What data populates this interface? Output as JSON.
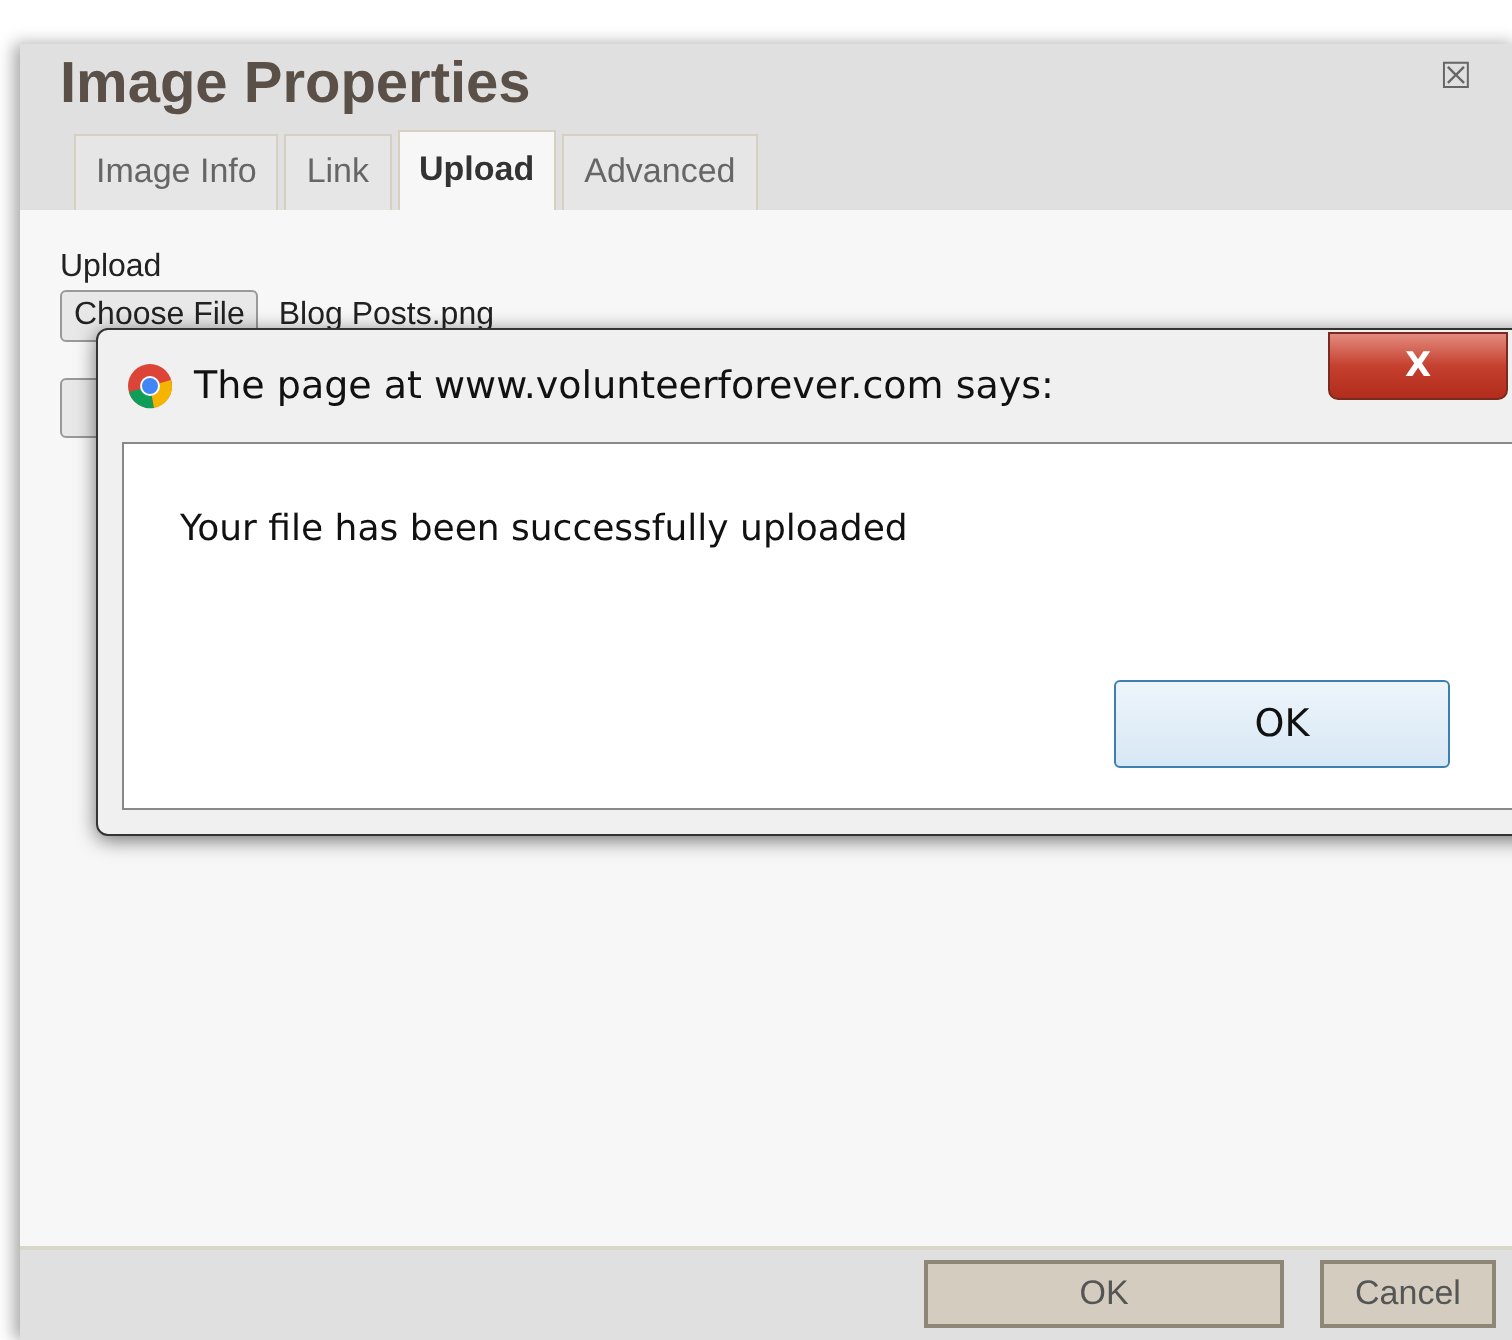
{
  "dialog": {
    "title": "Image Properties",
    "close_symbol": "☒",
    "tabs": [
      {
        "label": "Image Info",
        "selected": false
      },
      {
        "label": "Link",
        "selected": false
      },
      {
        "label": "Upload",
        "selected": true
      },
      {
        "label": "Advanced",
        "selected": false
      }
    ],
    "upload": {
      "label": "Upload",
      "button": "Choose File",
      "file_name": "Blog Posts.png"
    },
    "buttons": [
      "OK",
      "Cancel"
    ]
  },
  "alert": {
    "title": "The page at www.volunteerforever.com says:",
    "close_symbol": "X",
    "message": "Your file has been successfully uploaded",
    "button": "OK"
  }
}
